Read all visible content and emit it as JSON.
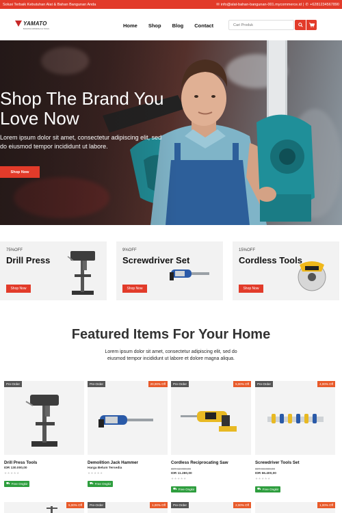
{
  "topbar": {
    "tagline": "Solusi Terbaik Kebutuhan Alat & Bahan Bangunan Anda",
    "email": "info@alat-bahan-bangunan-001.mycommerce.id",
    "separator": "|",
    "phone": "+6281234567890"
  },
  "header": {
    "logo_text": "YAMATO",
    "logo_subtext": "BUILDING MATERIALS & TOOLS",
    "nav": [
      "Home",
      "Shop",
      "Blog",
      "Contact"
    ],
    "search_placeholder": "Cari Produk"
  },
  "hero": {
    "title": "Shop The Brand You Love Now",
    "text": "Lorem ipsum dolor sit amet, consectetur adipiscing elit, sed do eiusmod tempor incididunt ut labore.",
    "button": "Shop Now"
  },
  "promos": [
    {
      "discount": "75%OFF",
      "name": "Drill Press",
      "button": "Shop Now"
    },
    {
      "discount": "9%OFF",
      "name": "Screwdriver Set",
      "button": "Shop Now"
    },
    {
      "discount": "15%OFF",
      "name": "Cordless Tools",
      "button": "Shop Now"
    }
  ],
  "featured": {
    "title": "Featured Items For Your Home",
    "text": "Lorem ipsum dolor sit amet, consectetur adipiscing elit, sed do eiusmod tempor incididunt ut labore et dolore magna aliqua."
  },
  "products": [
    {
      "tag": "Pre-Order",
      "discount": "",
      "name": "Drill Press Tools",
      "old_price": "",
      "price": "IDR 130.000,00",
      "stars": "★★★★★",
      "shipping": "Free Ongkir"
    },
    {
      "tag": "Pre-Order",
      "discount": "20,00% Off",
      "name": "Demolition Jack Hammer",
      "old_price": "",
      "price": "Harga Belum Tersedia",
      "stars": "★★★★★",
      "shipping": "Free Ongkir"
    },
    {
      "tag": "Pre-Order",
      "discount": "5,00% Off",
      "name": "Cordless Reciprocating Saw",
      "old_price": "IDR 12.000,00",
      "price": "IDR 11.280,00",
      "stars": "★★★★★",
      "shipping": "Free Ongkir"
    },
    {
      "tag": "Pre-Order",
      "discount": "4,00% Off",
      "name": "Screwdriver Tools Set",
      "old_price": "IDR 69.000,00",
      "price": "IDR 66.400,00",
      "stars": "★★★★★",
      "shipping": "Free Ongkir"
    }
  ],
  "products_row2": [
    {
      "tag": "",
      "discount": "5,00% Off"
    },
    {
      "tag": "Pre-Order",
      "discount": "1,00% Off"
    },
    {
      "tag": "Pre-Order",
      "discount": "2,00% Off"
    },
    {
      "tag": "",
      "discount": "1,00% Off"
    }
  ],
  "colors": {
    "accent": "#e23b2a",
    "shipping": "#2e9e3e",
    "discount": "#e85a2a"
  }
}
